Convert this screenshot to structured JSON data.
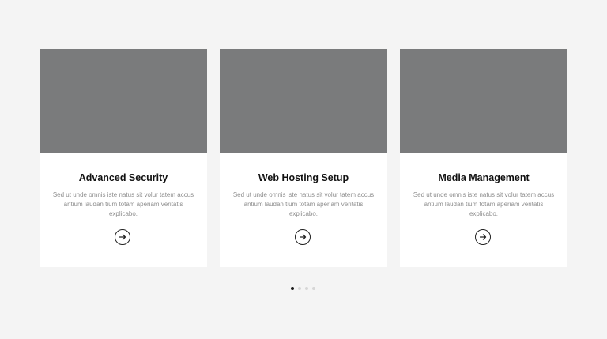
{
  "cards": [
    {
      "title": "Advanced Security",
      "description": "Sed ut unde omnis iste natus sit volur tatem accus antium laudan tium totam aperiam veritatis explicabo.",
      "icon": "arrow-right-icon"
    },
    {
      "title": "Web Hosting Setup",
      "description": "Sed ut unde omnis iste natus sit volur tatem accus antium laudan tium totam aperiam veritatis explicabo.",
      "icon": "arrow-right-icon"
    },
    {
      "title": "Media Management",
      "description": "Sed ut unde omnis iste natus sit volur tatem accus antium laudan tium totam aperiam veritatis explicabo.",
      "icon": "arrow-right-icon"
    }
  ],
  "pagination": {
    "total": 4,
    "active": 1
  },
  "colors": {
    "page_background": "#f4f4f4",
    "card_background": "#ffffff",
    "image_placeholder": "#7a7b7c",
    "title_text": "#111111",
    "body_text": "#8e8e8e",
    "dot_active": "#1a1a1a",
    "dot_inactive": "#d6d6d6"
  }
}
